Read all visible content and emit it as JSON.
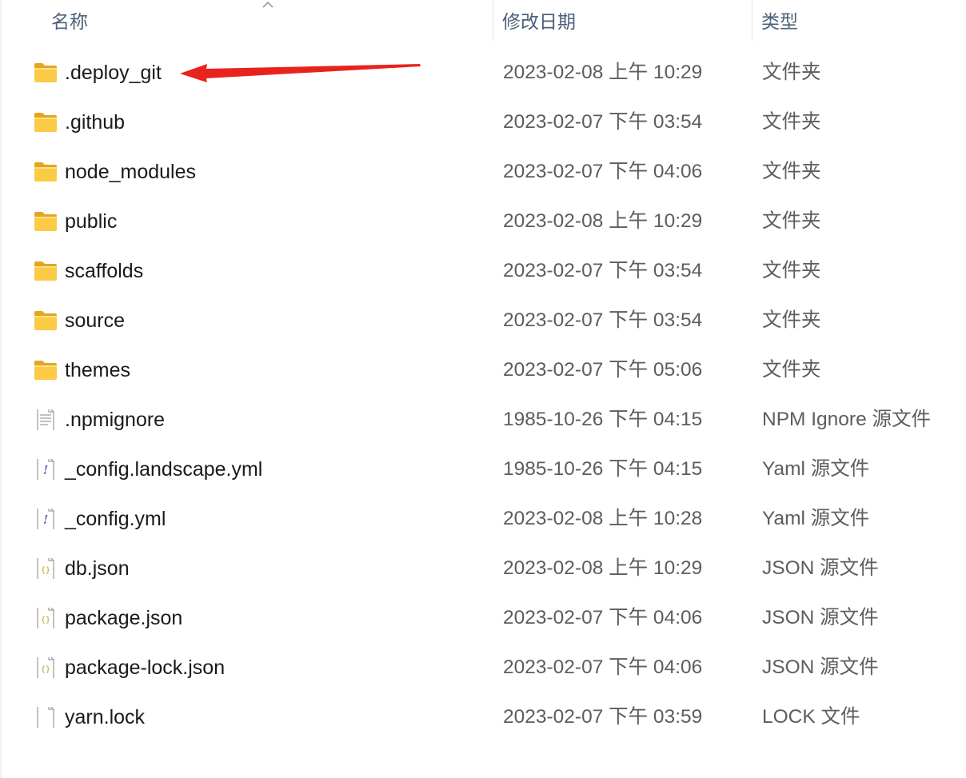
{
  "header": {
    "name_label": "名称",
    "date_label": "修改日期",
    "type_label": "类型",
    "sort_direction": "ascending"
  },
  "colors": {
    "header_text": "#4c607a",
    "folder": "#f8c33f",
    "annotation_arrow": "#e8231c"
  },
  "files": [
    {
      "name": ".deploy_git",
      "date": "2023-02-08 上午 10:29",
      "type": "文件夹",
      "icon": "folder-icon"
    },
    {
      "name": ".github",
      "date": "2023-02-07 下午 03:54",
      "type": "文件夹",
      "icon": "folder-icon"
    },
    {
      "name": "node_modules",
      "date": "2023-02-07 下午 04:06",
      "type": "文件夹",
      "icon": "folder-icon"
    },
    {
      "name": "public",
      "date": "2023-02-08 上午 10:29",
      "type": "文件夹",
      "icon": "folder-icon"
    },
    {
      "name": "scaffolds",
      "date": "2023-02-07 下午 03:54",
      "type": "文件夹",
      "icon": "folder-icon"
    },
    {
      "name": "source",
      "date": "2023-02-07 下午 03:54",
      "type": "文件夹",
      "icon": "folder-icon"
    },
    {
      "name": "themes",
      "date": "2023-02-07 下午 05:06",
      "type": "文件夹",
      "icon": "folder-icon"
    },
    {
      "name": ".npmignore",
      "date": "1985-10-26 下午 04:15",
      "type": "NPM Ignore 源文件",
      "icon": "text-file-icon"
    },
    {
      "name": "_config.landscape.yml",
      "date": "1985-10-26 下午 04:15",
      "type": "Yaml 源文件",
      "icon": "yaml-file-icon"
    },
    {
      "name": "_config.yml",
      "date": "2023-02-08 上午 10:28",
      "type": "Yaml 源文件",
      "icon": "yaml-file-icon"
    },
    {
      "name": "db.json",
      "date": "2023-02-08 上午 10:29",
      "type": "JSON 源文件",
      "icon": "json-file-icon"
    },
    {
      "name": "package.json",
      "date": "2023-02-07 下午 04:06",
      "type": "JSON 源文件",
      "icon": "json-file-icon"
    },
    {
      "name": "package-lock.json",
      "date": "2023-02-07 下午 04:06",
      "type": "JSON 源文件",
      "icon": "json-file-icon"
    },
    {
      "name": "yarn.lock",
      "date": "2023-02-07 下午 03:59",
      "type": "LOCK 文件",
      "icon": "blank-file-icon"
    }
  ]
}
